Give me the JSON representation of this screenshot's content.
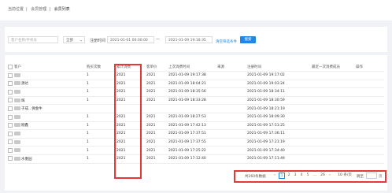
{
  "breadcrumb": {
    "items": [
      "当前位置",
      "会员管理",
      "会员列表"
    ]
  },
  "filter": {
    "search_placeholder": "客户名称/手机号",
    "select_value": "全部",
    "reg_time_label": "注册时间",
    "start_date": "2021-01-01 00:00:00",
    "dash": "—",
    "end_date": "2021-01-09 19:18:35",
    "clear_label": "清空筛选条件",
    "search_button": "搜索"
  },
  "table": {
    "columns": [
      "客户",
      "购买次数",
      "累计消费",
      "客单价",
      "上次消费时间",
      "来源",
      "注册时间",
      "最近一次消费成员",
      "操作"
    ],
    "rows": [
      {
        "name": "",
        "count": "1",
        "total": "2021",
        "price": "2021",
        "last": "2021-01-09 19:17:38",
        "reg": "2021-01-09 19:17:02"
      },
      {
        "name": "源达",
        "count": "1",
        "total": "2021",
        "price": "2021",
        "last": "2021-01-09 18:04:21",
        "reg": "2021-01-09 19:03:24"
      },
      {
        "name": "",
        "count": "1",
        "total": "2021",
        "price": "2021",
        "last": "2021-01-09 18:35:56",
        "reg": "2021-01-09 18:34:11"
      },
      {
        "name": "辉",
        "count": "1",
        "total": "2021",
        "price": "2021",
        "last": "2021-01-09 18:33:28",
        "reg": "2021-01-09 18:30:59"
      },
      {
        "name": "子成...保金牛",
        "count": "",
        "total": "",
        "price": "",
        "last": "",
        "reg": "2021-01-09 18:21:19"
      },
      {
        "name": "",
        "count": "1",
        "total": "2021",
        "price": "2021",
        "last": "2021-01-09 18:27:53",
        "reg": "2021-01-09 18:09:30"
      },
      {
        "name": "刚鑫",
        "count": "1",
        "total": "2021",
        "price": "2021",
        "last": "2021-01-09 17:42:13",
        "reg": "2021-01-09 17:51:25"
      },
      {
        "name": "",
        "count": "1",
        "total": "2021",
        "price": "2021",
        "last": "2021-01-09 17:37:51",
        "reg": "2021-01-09 17:36:11"
      },
      {
        "name": "",
        "count": "1",
        "total": "2021",
        "price": "2021",
        "last": "2021-01-09 17:37:55",
        "reg": "2021-01-09 17:21:19"
      },
      {
        "name": "",
        "count": "1",
        "total": "2021",
        "price": "2021",
        "last": "2021-01-09 17:25:22",
        "reg": "2021-01-09 17:34:40"
      },
      {
        "name": "水墨园",
        "count": "1",
        "total": "2021",
        "price": "2021",
        "last": "2021-01-09 17:12:40",
        "reg": "2021-01-09 17:11:49"
      }
    ]
  },
  "pager": {
    "total_text": "共260条数据",
    "prev": "‹",
    "pages": [
      "1",
      "2",
      "3",
      "4",
      "5",
      "...",
      "26"
    ],
    "next": "›",
    "per_page": "10 条/页",
    "goto_label": "跳至",
    "page_unit": "页"
  }
}
